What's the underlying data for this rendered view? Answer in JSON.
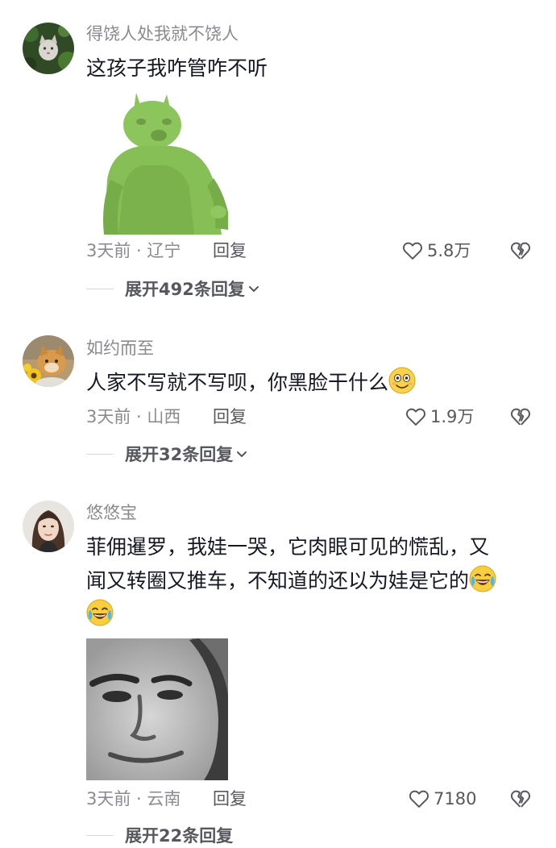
{
  "colors": {
    "username": "#8a8b91",
    "text": "#161823",
    "meta": "#8a8b91",
    "action": "#57585e"
  },
  "comments": [
    {
      "username": "得饶人处我就不饶人",
      "text": "这孩子我咋管咋不听",
      "text_emoji_trailing": [],
      "has_sticker": true,
      "sticker_name": "green-monster-sticker",
      "time_location": "3天前 · 辽宁",
      "reply_label": "回复",
      "likes": "5.8万",
      "expand_label": "展开492条回复"
    },
    {
      "username": "如约而至",
      "text": "人家不写就不写呗，你黑脸干什么",
      "text_emoji_trailing": [
        "smile-emoji"
      ],
      "has_sticker": false,
      "time_location": "3天前 · 山西",
      "reply_label": "回复",
      "likes": "1.9万",
      "expand_label": "展开32条回复"
    },
    {
      "username": "悠悠宝",
      "text_line1": "菲佣暹罗，我娃一哭，它肉眼可见的慌乱，又",
      "text_line2": "闻又转圈又推车，不知道的还以为娃是它的",
      "text_emoji_trailing": [
        "tears-of-joy-emoji",
        "tears-of-joy-emoji"
      ],
      "has_sticker": true,
      "sticker_name": "grayscale-face-sticker",
      "time_location": "3天前 · 云南",
      "reply_label": "回复",
      "likes": "7180",
      "expand_label": "展开22条回复"
    }
  ]
}
